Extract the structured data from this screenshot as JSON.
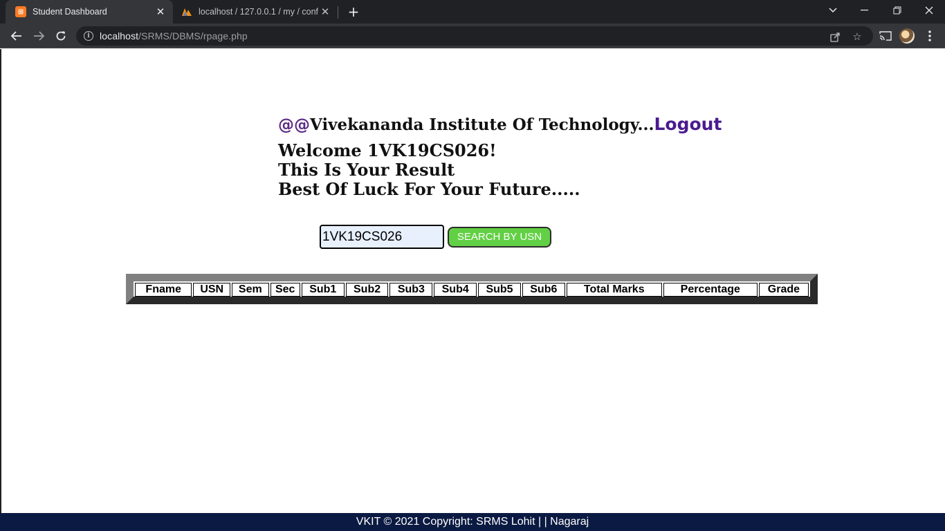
{
  "browser": {
    "tabs": [
      {
        "title": "Student Dashboard",
        "active": true
      },
      {
        "title": "localhost / 127.0.0.1 / my / conf",
        "active": false
      }
    ],
    "url": {
      "host": "localhost",
      "path": "/SRMS/DBMS/rpage.php"
    }
  },
  "header": {
    "at_prefix": "@@",
    "institute": "Vivekananda Institute Of Technology...",
    "logout_label": "Logout",
    "welcome": "Welcome 1VK19CS026!",
    "line2": "This Is Your Result",
    "line3": "Best Of Luck For Your Future....."
  },
  "search": {
    "value": "1VK19CS026",
    "button_label": "SEARCH BY USN"
  },
  "table": {
    "headers": [
      "Fname",
      "USN",
      "Sem",
      "Sec",
      "Sub1",
      "Sub2",
      "Sub3",
      "Sub4",
      "Sub5",
      "Sub6",
      "Total Marks",
      "Percentage",
      "Grade"
    ]
  },
  "footer": {
    "text": "VKIT © 2021 Copyright: SRMS Lohit | | Nagaraj"
  },
  "colors": {
    "accent_purple": "#4b1b8f",
    "button_green": "#62d044",
    "footer_bg": "#0b1a42"
  }
}
